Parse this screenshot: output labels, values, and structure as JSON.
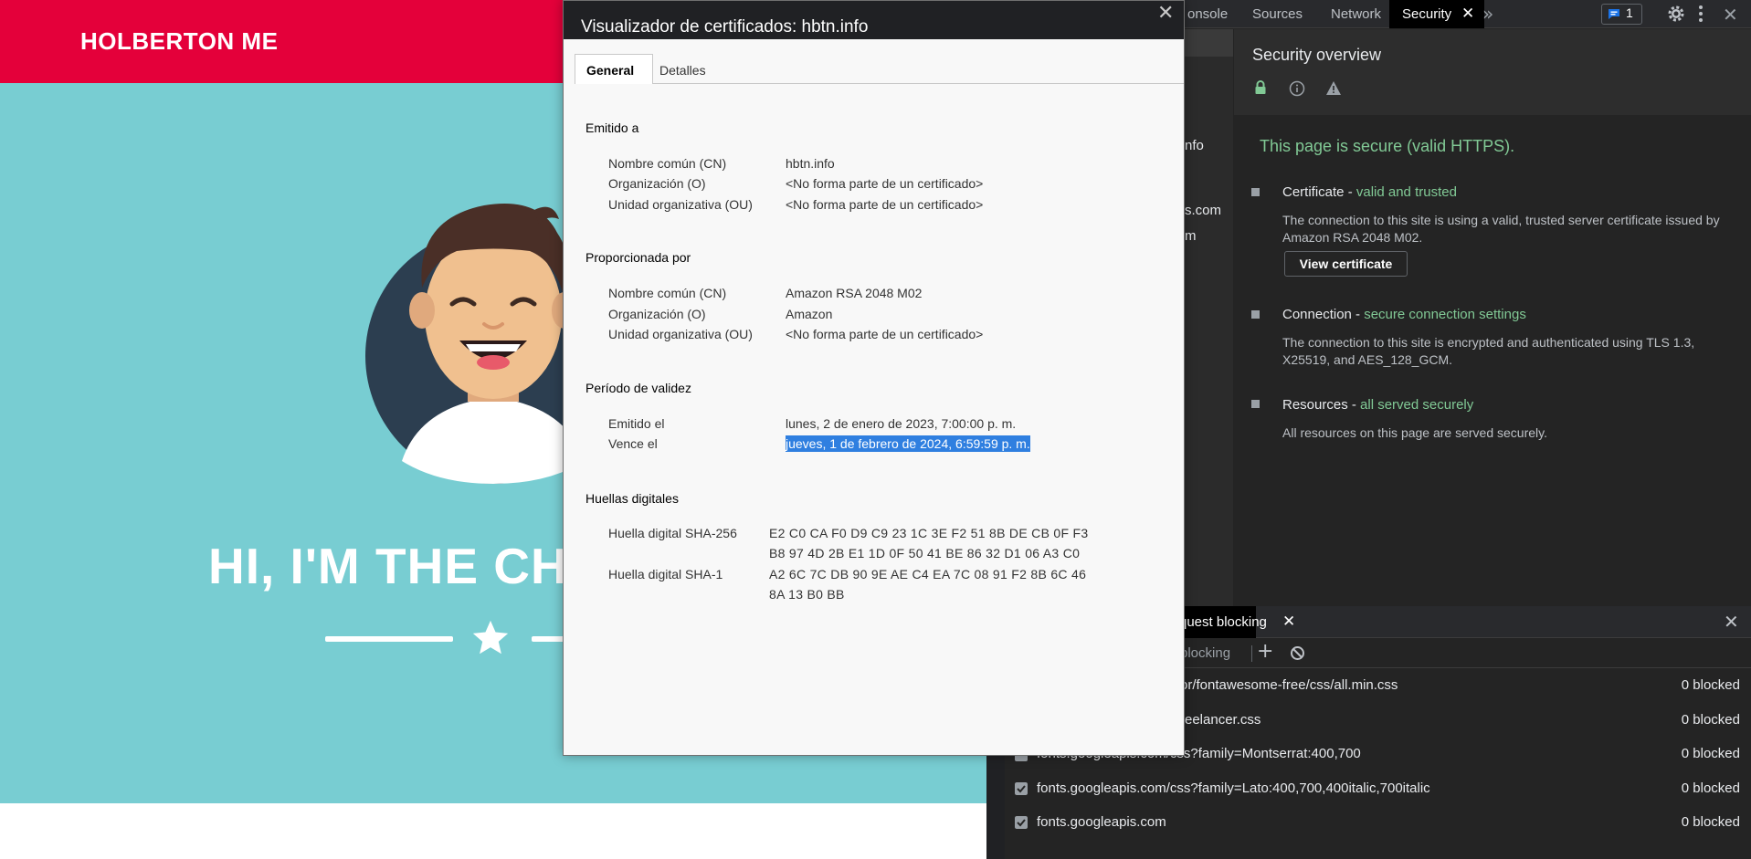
{
  "page": {
    "brand": "HOLBERTON ME",
    "hero_title": "HI, I'M THE CH"
  },
  "devtools": {
    "tabs": [
      "onsole",
      "Sources",
      "Network"
    ],
    "active_tab": "Security",
    "issues_count": "1",
    "sidebar_fragments": [
      "nfo",
      "s.com",
      "m"
    ],
    "security": {
      "title": "Security overview",
      "secure_message": "This page is secure (valid HTTPS).",
      "items": [
        {
          "head": "Certificate - ",
          "status": "valid and trusted",
          "desc": "The connection to this site is using a valid, trusted server certificate issued by Amazon RSA 2048 M02."
        },
        {
          "head": "Connection - ",
          "status": "secure connection settings",
          "desc": "The connection to this site is encrypted and authenticated using TLS 1.3, X25519, and AES_128_GCM."
        },
        {
          "head": "Resources - ",
          "status": "all served securely",
          "desc": "All resources on this page are served securely."
        }
      ],
      "view_certificate_label": "View certificate"
    },
    "drawer": {
      "tab_label": "quest blocking",
      "toolbar_label": "blocking",
      "rules": [
        {
          "pattern": "or/fontawesome-free/css/all.min.css",
          "count": "0 blocked",
          "checked": true
        },
        {
          "pattern": "reelancer.css",
          "count": "0 blocked",
          "checked": true
        },
        {
          "pattern": "fonts.googleapis.com/css?family=Montserrat:400,700",
          "count": "0 blocked",
          "checked": true
        },
        {
          "pattern": "fonts.googleapis.com/css?family=Lato:400,700,400italic,700italic",
          "count": "0 blocked",
          "checked": true
        },
        {
          "pattern": "fonts.googleapis.com",
          "count": "0 blocked",
          "checked": true
        }
      ]
    }
  },
  "cert_dialog": {
    "title": "Visualizador de certificados: hbtn.info",
    "tabs": [
      "General",
      "Detalles"
    ],
    "issued_to": {
      "heading": "Emitido a",
      "rows": [
        {
          "label": "Nombre común (CN)",
          "value": "hbtn.info"
        },
        {
          "label": "Organización (O)",
          "value": "<No forma parte de un certificado>"
        },
        {
          "label": "Unidad organizativa (OU)",
          "value": "<No forma parte de un certificado>"
        }
      ]
    },
    "issued_by": {
      "heading": "Proporcionada por",
      "rows": [
        {
          "label": "Nombre común (CN)",
          "value": "Amazon RSA 2048 M02"
        },
        {
          "label": "Organización (O)",
          "value": "Amazon"
        },
        {
          "label": "Unidad organizativa (OU)",
          "value": "<No forma parte de un certificado>"
        }
      ]
    },
    "validity": {
      "heading": "Período de validez",
      "issued_label": "Emitido el",
      "issued_value": "lunes, 2 de enero de 2023, 7:00:00 p. m.",
      "expires_label": "Vence el",
      "expires_value": "jueves, 1 de febrero de 2024, 6:59:59 p. m."
    },
    "fingerprints": {
      "heading": "Huellas digitales",
      "sha256_label": "Huella digital SHA-256",
      "sha256_line1": "E2 C0 CA F0 D9 C9 23 1C 3E F2 51 8B DE CB 0F F3",
      "sha256_line2": "B8 97 4D 2B E1 1D 0F 50 41 BE 86 32 D1 06 A3 C0",
      "sha1_label": "Huella digital SHA-1",
      "sha1_line1": "A2 6C 7C DB 90 9E AE C4 EA 7C 08 91 F2 8B 6C 46",
      "sha1_line2": "8A 13 B0 BB"
    }
  },
  "colors": {
    "nav_red": "#e4003a",
    "masthead_teal": "#78cdd2",
    "secure_green": "#81c995",
    "selection_blue": "#2f7fe0"
  }
}
